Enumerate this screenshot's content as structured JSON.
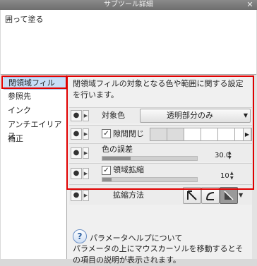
{
  "window": {
    "title": "サブツール詳細",
    "close_glyph": "✕"
  },
  "tool": {
    "name": "囲って塗る"
  },
  "categories": [
    "閉領域フィル",
    "参照先",
    "インク",
    "アンチエイリアス",
    "補正"
  ],
  "panel": {
    "description": "閉領域フィルの対象となる色や範囲に関する設定を行います。",
    "rows": {
      "target_color": {
        "label": "対象色",
        "value": "透明部分のみ"
      },
      "gap_close": {
        "label": "隙間閉じ",
        "checked": true
      },
      "color_margin": {
        "label": "色の誤差",
        "value": "30.0",
        "fraction": 0.3
      },
      "area_scaling": {
        "label": "領域拡縮",
        "checked": true,
        "value": "10",
        "fraction": 0.1
      },
      "scaling_method": {
        "label": "拡縮方法"
      }
    }
  },
  "help": {
    "title": "パラメータヘルプについて",
    "text": "パラメータの上にマウスカーソルを移動するとその項目の説明が表示されます。",
    "icon_glyph": "?"
  },
  "glyphs": {
    "eye": "●",
    "expand": "▶",
    "check": "✓",
    "dropdown": "▼",
    "spin_up": "▲",
    "spin_down": "▼",
    "arrow_right": "▶"
  },
  "colors": {
    "highlight": "#e00000",
    "selection": "#c8def8"
  }
}
